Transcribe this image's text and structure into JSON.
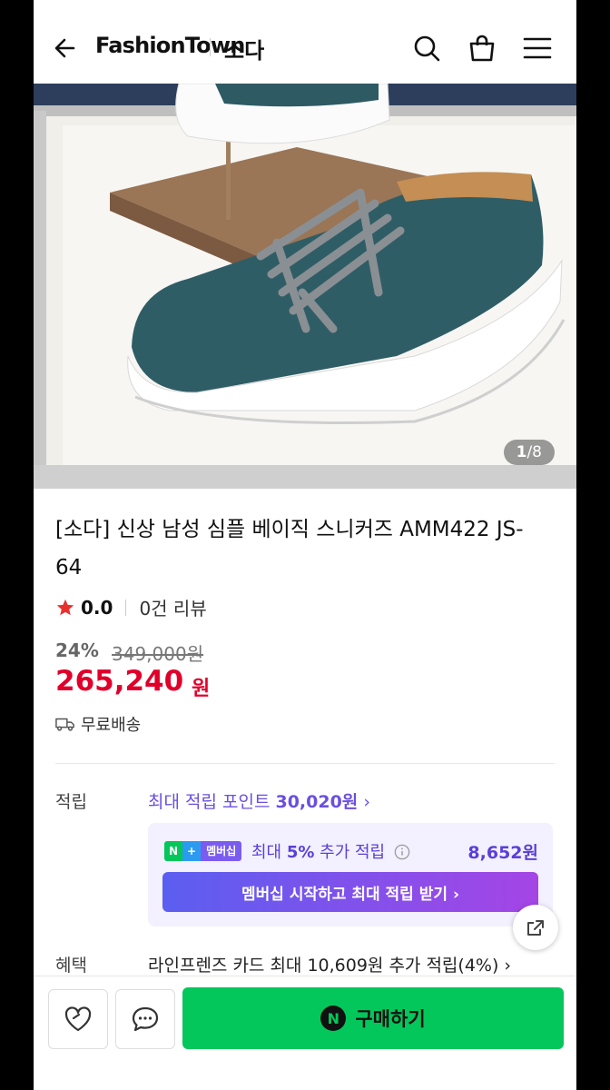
{
  "header": {
    "brand": "FashionTown",
    "store": "소다"
  },
  "gallery": {
    "current": "1",
    "total": "/8"
  },
  "product": {
    "title": "[소다] 신상 남성 심플 베이직 스니커즈 AMM422 JS-64",
    "rating": "0.0",
    "reviews": "0건 리뷰",
    "discount": "24%",
    "original_price": "349,000원",
    "price": "265,240",
    "currency": "원",
    "shipping": "무료배송"
  },
  "points": {
    "label": "적립",
    "text_prefix": "최대 적립 포인트 ",
    "text_amount": "30,020원",
    "chevron": "›"
  },
  "membership": {
    "badge_n": "N",
    "badge_plus": "+",
    "badge_label": "멤버십",
    "text_prefix": "최대 ",
    "text_rate": "5%",
    "text_suffix": " 추가 적립",
    "amount": "8,652원",
    "button": "멤버십 시작하고 최대 적립 받기 ›"
  },
  "benefit": {
    "label": "혜택",
    "text": "라인프렌즈 카드 최대 10,609원 추가 적립(4%) ›"
  },
  "bottom": {
    "buy_label": "구매하기",
    "buy_icon_letter": "N"
  },
  "colors": {
    "accent_price": "#e0002a",
    "membership_purple": "#5a3fd8",
    "buy_green": "#03c75a"
  }
}
